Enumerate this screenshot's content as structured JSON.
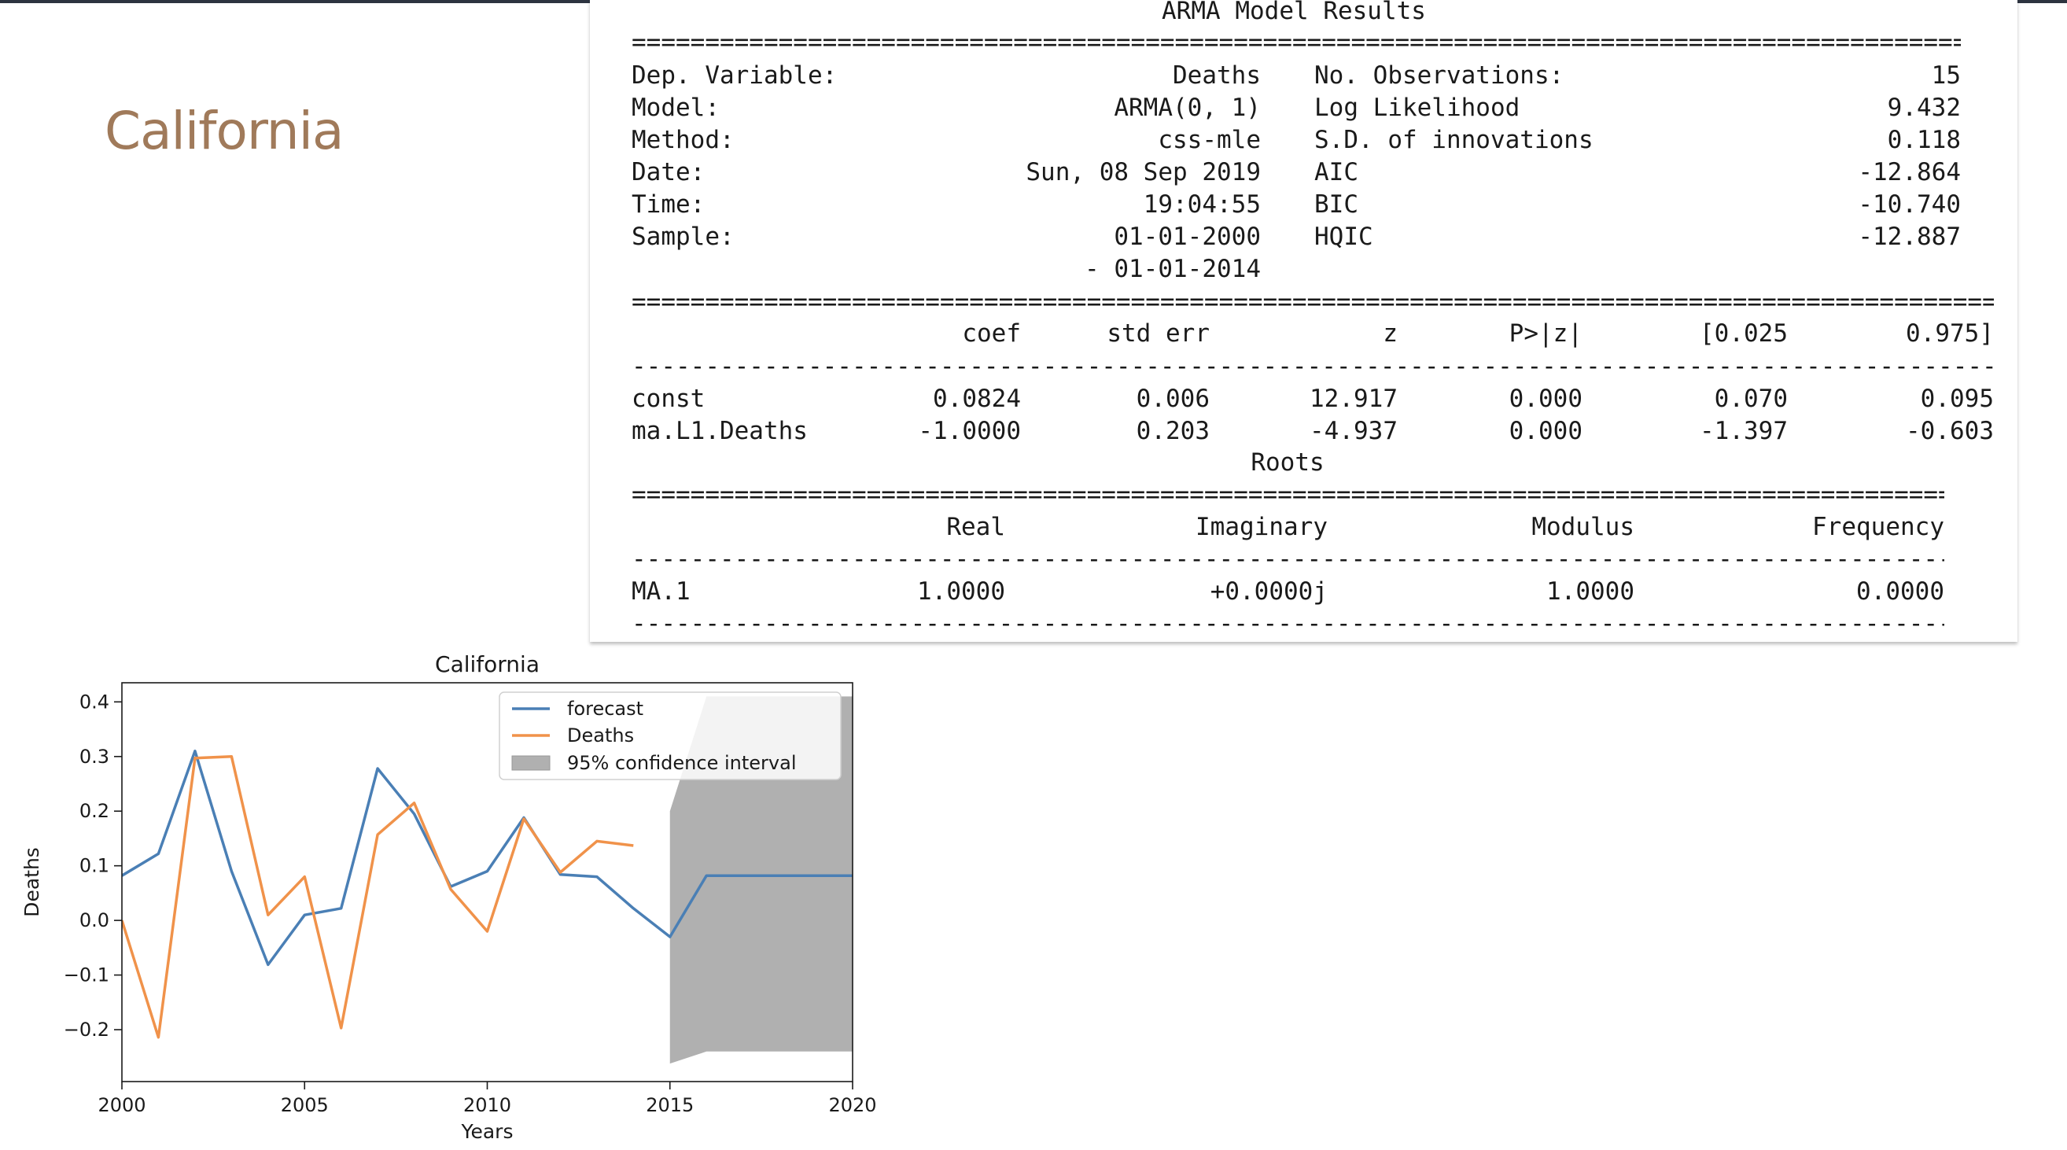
{
  "slide": {
    "title": "California"
  },
  "summary": {
    "title": "ARMA Model Results",
    "info": [
      {
        "label": "Dep. Variable:",
        "value": "Deaths",
        "label2": "No. Observations:",
        "value2": "15"
      },
      {
        "label": "Model:",
        "value": "ARMA(0, 1)",
        "label2": "Log Likelihood",
        "value2": "9.432"
      },
      {
        "label": "Method:",
        "value": "css-mle",
        "label2": "S.D. of innovations",
        "value2": "0.118"
      },
      {
        "label": "Date:",
        "value": "Sun, 08 Sep 2019",
        "label2": "AIC",
        "value2": "-12.864"
      },
      {
        "label": "Time:",
        "value": "19:04:55",
        "label2": "BIC",
        "value2": "-10.740"
      },
      {
        "label": "Sample:",
        "value": "01-01-2000",
        "label2": "HQIC",
        "value2": "-12.887"
      },
      {
        "label": "",
        "value": "- 01-01-2014",
        "label2": "",
        "value2": ""
      }
    ],
    "coef_headers": [
      "coef",
      "std err",
      "z",
      "P>|z|",
      "[0.025",
      "0.975]"
    ],
    "coef_rows": [
      {
        "name": "const",
        "vals": [
          "0.0824",
          "0.006",
          "12.917",
          "0.000",
          "0.070",
          "0.095"
        ]
      },
      {
        "name": "ma.L1.Deaths",
        "vals": [
          "-1.0000",
          "0.203",
          "-4.937",
          "0.000",
          "-1.397",
          "-0.603"
        ]
      }
    ],
    "roots_title": "Roots",
    "roots_headers": [
      "Real",
      "Imaginary",
      "Modulus",
      "Frequency"
    ],
    "roots_rows": [
      {
        "name": "MA.1",
        "vals": [
          "1.0000",
          "+0.0000j",
          "1.0000",
          "0.0000"
        ]
      }
    ]
  },
  "chart_data": {
    "type": "line",
    "title": "California",
    "xlabel": "Years",
    "ylabel": "Deaths",
    "xlim": [
      2000,
      2020
    ],
    "ylim": [
      -0.295,
      0.435
    ],
    "xticks": [
      2000,
      2005,
      2010,
      2015,
      2020
    ],
    "yticks": [
      0.4,
      0.3,
      0.2,
      0.1,
      0.0,
      -0.1,
      -0.2
    ],
    "ytick_labels": [
      "0.4",
      "0.3",
      "0.2",
      "0.1",
      "0.0",
      "−0.1",
      "−0.2"
    ],
    "legend_position": "top-right",
    "series": [
      {
        "name": "forecast",
        "color": "#4a7fb5",
        "x": [
          2000,
          2001,
          2002,
          2003,
          2004,
          2005,
          2006,
          2007,
          2008,
          2009,
          2010,
          2011,
          2012,
          2013,
          2014,
          2015,
          2016,
          2017,
          2018,
          2019,
          2020
        ],
        "y": [
          0.082,
          0.122,
          0.31,
          0.09,
          -0.081,
          0.01,
          0.022,
          0.278,
          0.195,
          0.062,
          0.09,
          0.188,
          0.084,
          0.08,
          0.022,
          -0.03,
          0.082,
          0.082,
          0.082,
          0.082,
          0.082
        ]
      },
      {
        "name": "Deaths",
        "color": "#f0924a",
        "x": [
          2000,
          2001,
          2002,
          2003,
          2004,
          2005,
          2006,
          2007,
          2008,
          2009,
          2010,
          2011,
          2012,
          2013,
          2014
        ],
        "y": [
          0.0,
          -0.214,
          0.297,
          0.3,
          0.01,
          0.08,
          -0.197,
          0.157,
          0.215,
          0.057,
          -0.02,
          0.186,
          0.088,
          0.145,
          0.137
        ]
      }
    ],
    "confidence_band": {
      "name": "95% confidence interval",
      "color": "#b0b0b0",
      "x": [
        2015,
        2016,
        2017,
        2018,
        2019,
        2020
      ],
      "lower": [
        -0.262,
        -0.24,
        -0.24,
        -0.24,
        -0.24,
        -0.24
      ],
      "upper": [
        0.2,
        0.41,
        0.41,
        0.41,
        0.41,
        0.41
      ]
    }
  }
}
